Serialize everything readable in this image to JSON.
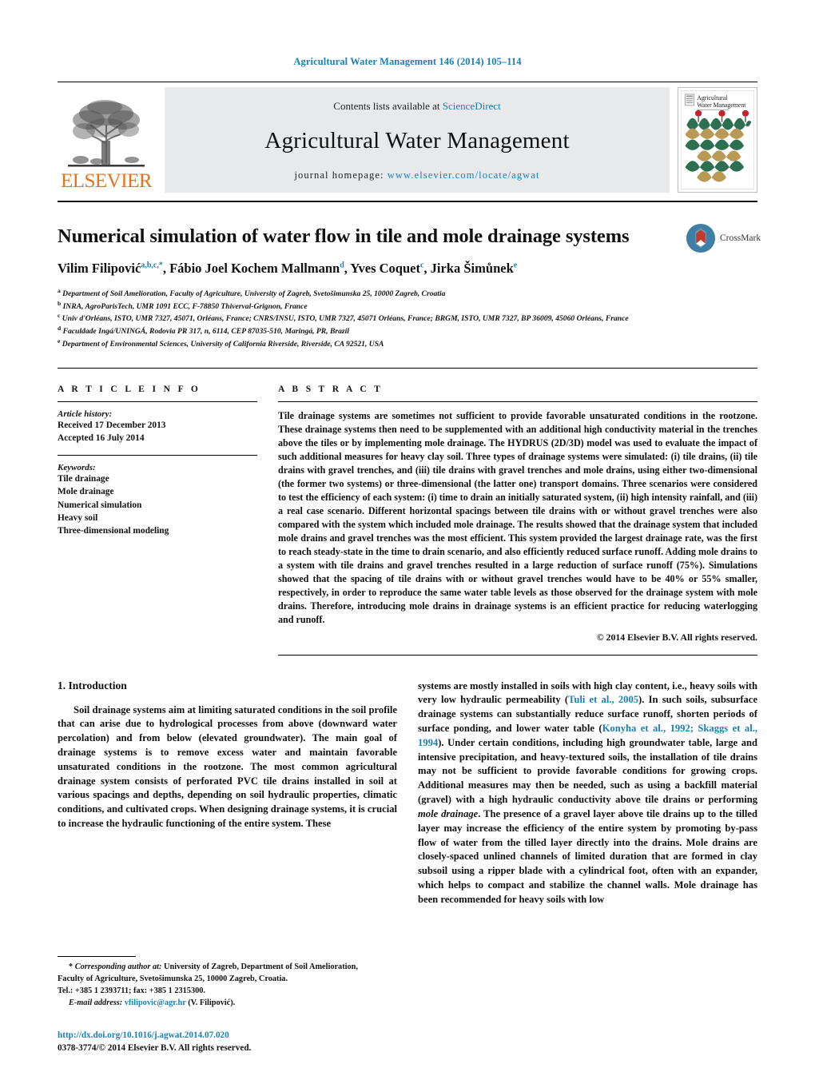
{
  "running_head": "Agricultural Water Management 146 (2014) 105–114",
  "masthead": {
    "publisher": "ELSEVIER",
    "contents_prefix": "Contents lists available at ",
    "contents_link": "ScienceDirect",
    "journal_name": "Agricultural Water Management",
    "homepage_label": "journal homepage: ",
    "homepage_url": "www.elsevier.com/locate/agwat",
    "cover_title_line1": "Agricultural",
    "cover_title_line2": "Water Management"
  },
  "article": {
    "title": "Numerical simulation of water flow in tile and mole drainage systems",
    "crossmark_label": "CrossMark",
    "authors_html": "Vilim Filipović<sup>a,b,c,</sup><sup>*</sup>, Fábio Joel Kochem Mallmann<sup>d</sup>, Yves Coquet<sup>c</sup>, Jirka Šimůnek<sup>e</sup>",
    "affiliations": [
      {
        "marker": "a",
        "text": "Department of Soil Amelioration, Faculty of Agriculture, University of Zagreb, Svetošimunska 25, 10000 Zagreb, Croatia"
      },
      {
        "marker": "b",
        "text": "INRA, AgroParisTech, UMR 1091 ECC, F-78850 Thiverval-Grignon, France"
      },
      {
        "marker": "c",
        "text": "Univ d'Orléans, ISTO, UMR 7327, 45071, Orléans, France; CNRS/INSU, ISTO, UMR 7327, 45071 Orléans, France; BRGM, ISTO, UMR 7327, BP 36009, 45060 Orléans, France"
      },
      {
        "marker": "d",
        "text": "Faculdade Ingá/UNINGÁ, Rodovia PR 317, n, 6114, CEP 87035-510, Maringá, PR, Brazil"
      },
      {
        "marker": "e",
        "text": "Department of Environmental Sciences, University of California Riverside, Riverside, CA 92521, USA"
      }
    ]
  },
  "article_info": {
    "heading": "A R T I C L E   I N F O",
    "history_label": "Article history:",
    "history": [
      "Received 17 December 2013",
      "Accepted 16 July 2014"
    ],
    "keywords_label": "Keywords:",
    "keywords": [
      "Tile drainage",
      "Mole drainage",
      "Numerical simulation",
      "Heavy soil",
      "Three-dimensional modeling"
    ]
  },
  "abstract": {
    "heading": "A B S T R A C T",
    "text": "Tile drainage systems are sometimes not sufficient to provide favorable unsaturated conditions in the rootzone. These drainage systems then need to be supplemented with an additional high conductivity material in the trenches above the tiles or by implementing mole drainage. The HYDRUS (2D/3D) model was used to evaluate the impact of such additional measures for heavy clay soil. Three types of drainage systems were simulated: (i) tile drains, (ii) tile drains with gravel trenches, and (iii) tile drains with gravel trenches and mole drains, using either two-dimensional (the former two systems) or three-dimensional (the latter one) transport domains. Three scenarios were considered to test the efficiency of each system: (i) time to drain an initially saturated system, (ii) high intensity rainfall, and (iii) a real case scenario. Different horizontal spacings between tile drains with or without gravel trenches were also compared with the system which included mole drainage. The results showed that the drainage system that included mole drains and gravel trenches was the most efficient. This system provided the largest drainage rate, was the first to reach steady-state in the time to drain scenario, and also efficiently reduced surface runoff. Adding mole drains to a system with tile drains and gravel trenches resulted in a large reduction of surface runoff (75%). Simulations showed that the spacing of tile drains with or without gravel trenches would have to be 40% or 55% smaller, respectively, in order to reproduce the same water table levels as those observed for the drainage system with mole drains. Therefore, introducing mole drains in drainage systems is an efficient practice for reducing waterlogging and runoff.",
    "copyright": "© 2014 Elsevier B.V. All rights reserved."
  },
  "introduction": {
    "section_title": "1.  Introduction",
    "left_paragraph": "Soil drainage systems aim at limiting saturated conditions in the soil profile that can arise due to hydrological processes from above (downward water percolation) and from below (elevated groundwater). The main goal of drainage systems is to remove excess water and maintain favorable unsaturated conditions in the rootzone. The most common agricultural drainage system consists of perforated PVC tile drains installed in soil at various spacings and depths, depending on soil hydraulic properties, climatic conditions, and cultivated crops. When designing drainage systems, it is crucial to increase the hydraulic functioning of the entire system. These",
    "right_paragraph_html": "systems are mostly installed in soils with high clay content, i.e., heavy soils with very low hydraulic permeability (<span class=\"cite\">Tuli et al., 2005</span>). In such soils, subsurface drainage systems can substantially reduce surface runoff, shorten periods of surface ponding, and lower water table (<span class=\"cite\">Konyha et al., 1992; Skaggs et al., 1994</span>). Under certain conditions, including high groundwater table, large and intensive precipitation, and heavy-textured soils, the installation of tile drains may not be sufficient to provide favorable conditions for growing crops. Additional measures may then be needed, such as using a backfill material (gravel) with a high hydraulic conductivity above tile drains or performing <span class=\"ital\">mole drainage</span>. The presence of a gravel layer above tile drains up to the tilled layer may increase the efficiency of the entire system by promoting by-pass flow of water from the tilled layer directly into the drains. Mole drains are closely-spaced unlined channels of limited duration that are formed in clay subsoil using a ripper blade with a cylindrical foot, often with an expander, which helps to compact and stabilize the channel walls. Mole drainage has been recommended for heavy soils with low"
  },
  "footnote": {
    "corresponding_html": "* <span class=\"fn-em\">Corresponding author at:</span> University of Zagreb, Department of Soil Amelioration, Faculty of Agriculture, Svetošimunska 25, 10000 Zagreb, Croatia.",
    "tel_line": "Tel.: +385 1 2393711; fax: +385 1 2315300.",
    "email_label": "E-mail address:",
    "email": "vfilipovic@agr.hr",
    "email_suffix": "(V. Filipović).",
    "doi": "http://dx.doi.org/10.1016/j.agwat.2014.07.020",
    "issn": "0378-3774/© 2014 Elsevier B.V. All rights reserved."
  },
  "colors": {
    "link_blue": "#1a7fb5",
    "elsevier_orange": "#E9711C",
    "masthead_gray": "#e8e9ea",
    "cover_green": "#2e6f52",
    "cover_tan": "#b99a55",
    "cover_red": "#c3252a"
  }
}
